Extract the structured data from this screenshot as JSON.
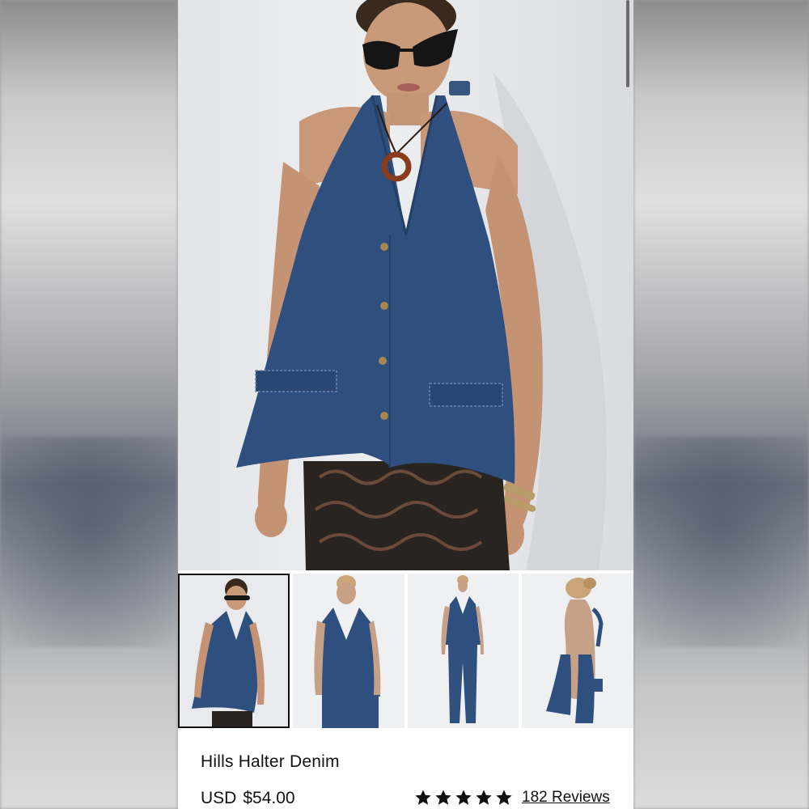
{
  "product": {
    "name": "Hills Halter Denim",
    "currency": "USD",
    "price": "$54.00",
    "rating": 5,
    "reviews_label": "182 Reviews"
  },
  "gallery": {
    "thumbnail_count": 4,
    "selected_index": 0,
    "thumbnails": [
      "front-view-sunglasses",
      "front-view-with-jeans",
      "full-length-view",
      "back-view"
    ]
  },
  "colors": {
    "denim": "#2f4f7f",
    "star": "#111111"
  }
}
